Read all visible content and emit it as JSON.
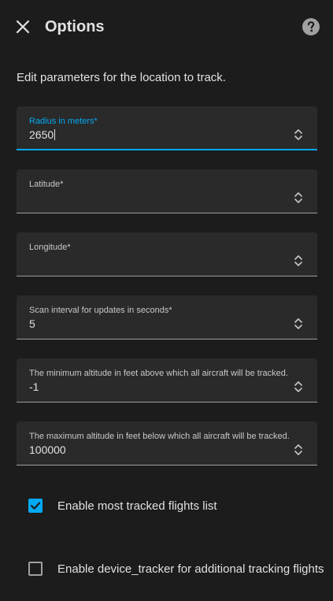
{
  "header": {
    "title": "Options"
  },
  "description": "Edit parameters for the location to track.",
  "fields": [
    {
      "label": "Radius in meters*",
      "value": "2650"
    },
    {
      "label": "Latitude*",
      "value": ""
    },
    {
      "label": "Longitude*",
      "value": ""
    },
    {
      "label": "Scan interval for updates in seconds*",
      "value": "5"
    },
    {
      "label": "The minimum altitude in feet above which all aircraft will be tracked.",
      "value": "-1"
    },
    {
      "label": "The maximum altitude in feet below which all aircraft will be tracked.",
      "value": "100000"
    }
  ],
  "checkboxes": [
    {
      "label": "Enable most tracked flights list",
      "checked": true
    },
    {
      "label": "Enable device_tracker for additional tracking flights",
      "checked": false
    }
  ],
  "colors": {
    "accent": "#03a9f4",
    "background": "#1c1c1c",
    "field_background": "#2a2a2a"
  },
  "icons": {
    "close": "close-icon",
    "help": "help-circle-icon",
    "spinner": "chevron-up-down-icon",
    "check": "check-icon"
  }
}
